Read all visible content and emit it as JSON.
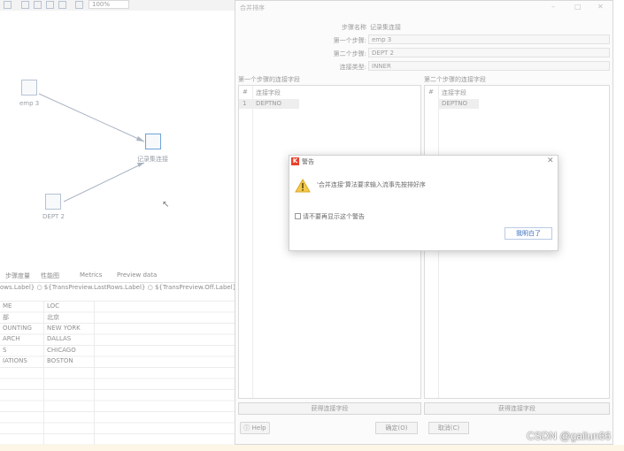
{
  "toolbar": {
    "zoom": "100%"
  },
  "canvas": {
    "nodes": [
      {
        "label": "emp 3"
      },
      {
        "label": "记录集连接"
      },
      {
        "label": "DEPT 2"
      }
    ]
  },
  "bottom_panel": {
    "tabs": [
      "步骤度量",
      "性能图",
      "Metrics",
      "Preview data"
    ],
    "radios": [
      "ows.Label}",
      "${TransPreview.LastRows.Label}",
      "${TransPreview.Off.Label}"
    ],
    "columns": [
      "ME",
      "LOC"
    ],
    "rows": [
      [
        "部",
        "北京"
      ],
      [
        "OUNTING",
        "NEW YORK"
      ],
      [
        "ARCH",
        "DALLAS"
      ],
      [
        "S",
        "CHICAGO"
      ],
      [
        "IATIONS",
        "BOSTON"
      ]
    ]
  },
  "dialog": {
    "title": "合并排序",
    "step_name_label": "步骤名称",
    "step_name_value": "记录集连接",
    "first_step_label": "第一个步骤:",
    "first_step_value": "emp 3",
    "second_step_label": "第二个步骤:",
    "second_step_value": "DEPT 2",
    "join_type_label": "连接类型:",
    "join_type_value": "INNER",
    "left_section": "第一个步骤的连接字段",
    "right_section": "第二个步骤的连接字段",
    "col_num": "#",
    "col_field": "连接字段",
    "left_rows": [
      {
        "num": "1",
        "field": "DEPTNO"
      }
    ],
    "right_rows": [
      {
        "num": "",
        "field": "DEPTNO"
      }
    ],
    "get_fields_left": "获得连接字段",
    "get_fields_right": "获得连接字段",
    "help": "Help",
    "ok": "确定(O)",
    "cancel": "取消(C)"
  },
  "warning": {
    "title": "警告",
    "message": "'合并连接'算法要求输入流事先按排好序",
    "checkbox_label": "请不要再显示这个警告",
    "ok_button": "我明白了",
    "accent": "#e8412c"
  },
  "watermark": "CSDN @gailun66"
}
